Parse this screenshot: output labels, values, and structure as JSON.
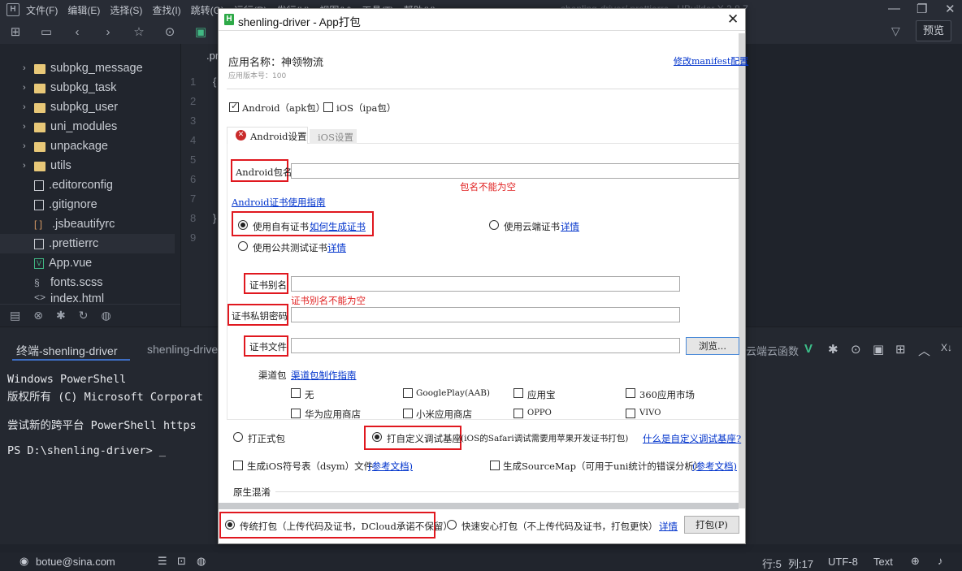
{
  "app": {
    "window_title": "shenling-driver/.prettierrc - HBuilder X 3.8.7",
    "menu": [
      "文件(F)",
      "编辑(E)",
      "选择(S)",
      "查找(I)",
      "跳转(G)",
      "运行(R)",
      "发行(U)",
      "视图(V)",
      "工具(T)",
      "帮助(Y)"
    ],
    "preview_button": "预览",
    "editor_tab": ".prettierrc",
    "line_numbers": [
      "1",
      "2",
      "3",
      "4",
      "5",
      "6",
      "7",
      "8",
      "9"
    ],
    "code_brace_open": "{",
    "code_brace_close": "}"
  },
  "sidebar": {
    "items": [
      {
        "label": "subpkg_message",
        "type": "folder"
      },
      {
        "label": "subpkg_task",
        "type": "folder"
      },
      {
        "label": "subpkg_user",
        "type": "folder"
      },
      {
        "label": "uni_modules",
        "type": "folder"
      },
      {
        "label": "unpackage",
        "type": "folder"
      },
      {
        "label": "utils",
        "type": "folder"
      },
      {
        "label": ".editorconfig",
        "type": "file"
      },
      {
        "label": ".gitignore",
        "type": "file"
      },
      {
        "label": ".jsbeautifyrc",
        "type": "json"
      },
      {
        "label": ".prettierrc",
        "type": "file",
        "selected": true
      },
      {
        "label": "App.vue",
        "type": "vue"
      },
      {
        "label": "fonts.scss",
        "type": "scss"
      },
      {
        "label": "index.html",
        "type": "html"
      }
    ]
  },
  "terminal": {
    "tabs": [
      "终端-shenling-driver",
      "shenling-driver"
    ],
    "right_label": "云端云函数",
    "lines": [
      "Windows PowerShell",
      "版权所有 (C) Microsoft Corporat",
      "",
      "尝试新的跨平台 PowerShell https",
      "",
      "PS D:\\shenling-driver> _"
    ]
  },
  "statusbar": {
    "user": "botue@sina.com",
    "line": "行:5",
    "col": "列:17",
    "encoding": "UTF-8",
    "mode": "Text"
  },
  "dialog": {
    "title": "shenling-driver - App打包",
    "app_name": "应用名称：神领物流",
    "app_version": "应用版本号：100",
    "manifest_link": "修改manifest配置",
    "platforms": [
      {
        "label": "Android（apk包）",
        "checked": true
      },
      {
        "label": "iOS（ipa包）",
        "checked": false
      }
    ],
    "tabs": [
      "Android设置",
      "iOS设置"
    ],
    "package_name_label": "Android包名",
    "package_name_value": "",
    "package_name_error": "包名不能为空",
    "cert_guide_link": "Android证书使用指南",
    "cert_options": [
      {
        "label": "使用自有证书",
        "link": "如何生成证书",
        "selected": true
      },
      {
        "label": "使用云端证书",
        "link": "详情",
        "selected": false
      },
      {
        "label": "使用公共测试证书",
        "link": "详情",
        "selected": false
      }
    ],
    "cert_alias_label": "证书别名",
    "cert_alias_value": "",
    "cert_alias_error": "证书别名不能为空",
    "cert_password_label": "证书私钥密码",
    "cert_password_value": "",
    "cert_file_label": "证书文件",
    "cert_file_value": "",
    "browse_button": "浏览...",
    "channel_label": "渠道包",
    "channel_link": "渠道包制作指南",
    "channels": [
      {
        "label": "无",
        "checked": false
      },
      {
        "label": "GooglePlay(AAB)",
        "checked": false
      },
      {
        "label": "应用宝",
        "checked": false
      },
      {
        "label": "360应用市场",
        "checked": false
      },
      {
        "label": "华为应用商店",
        "checked": false
      },
      {
        "label": "小米应用商店",
        "checked": false
      },
      {
        "label": "OPPO",
        "checked": false
      },
      {
        "label": "VIVO",
        "checked": false
      }
    ],
    "build_types": [
      {
        "label": "打正式包",
        "selected": false
      },
      {
        "label": "打自定义调试基座",
        "selected": true
      }
    ],
    "build_type_note": "(iOS的Safari调试需要用苹果开发证书打包)",
    "custom_base_link": "什么是自定义调试基座?",
    "dsym_label": "生成iOS符号表（dsym）文件",
    "dsym_link": "(参考文档)",
    "sourcemap_label": "生成SourceMap（可用于uni统计的错误分析）",
    "sourcemap_link": "(参考文档)",
    "obfuscation_label": "原生混淆",
    "pack_modes": [
      {
        "label": "传统打包（上传代码及证书，DCloud承诺不保留）",
        "selected": true
      },
      {
        "label": "快速安心打包（不上传代码及证书，打包更快）",
        "selected": false
      }
    ],
    "details_link": "详情",
    "pack_button": "打包(P)"
  }
}
